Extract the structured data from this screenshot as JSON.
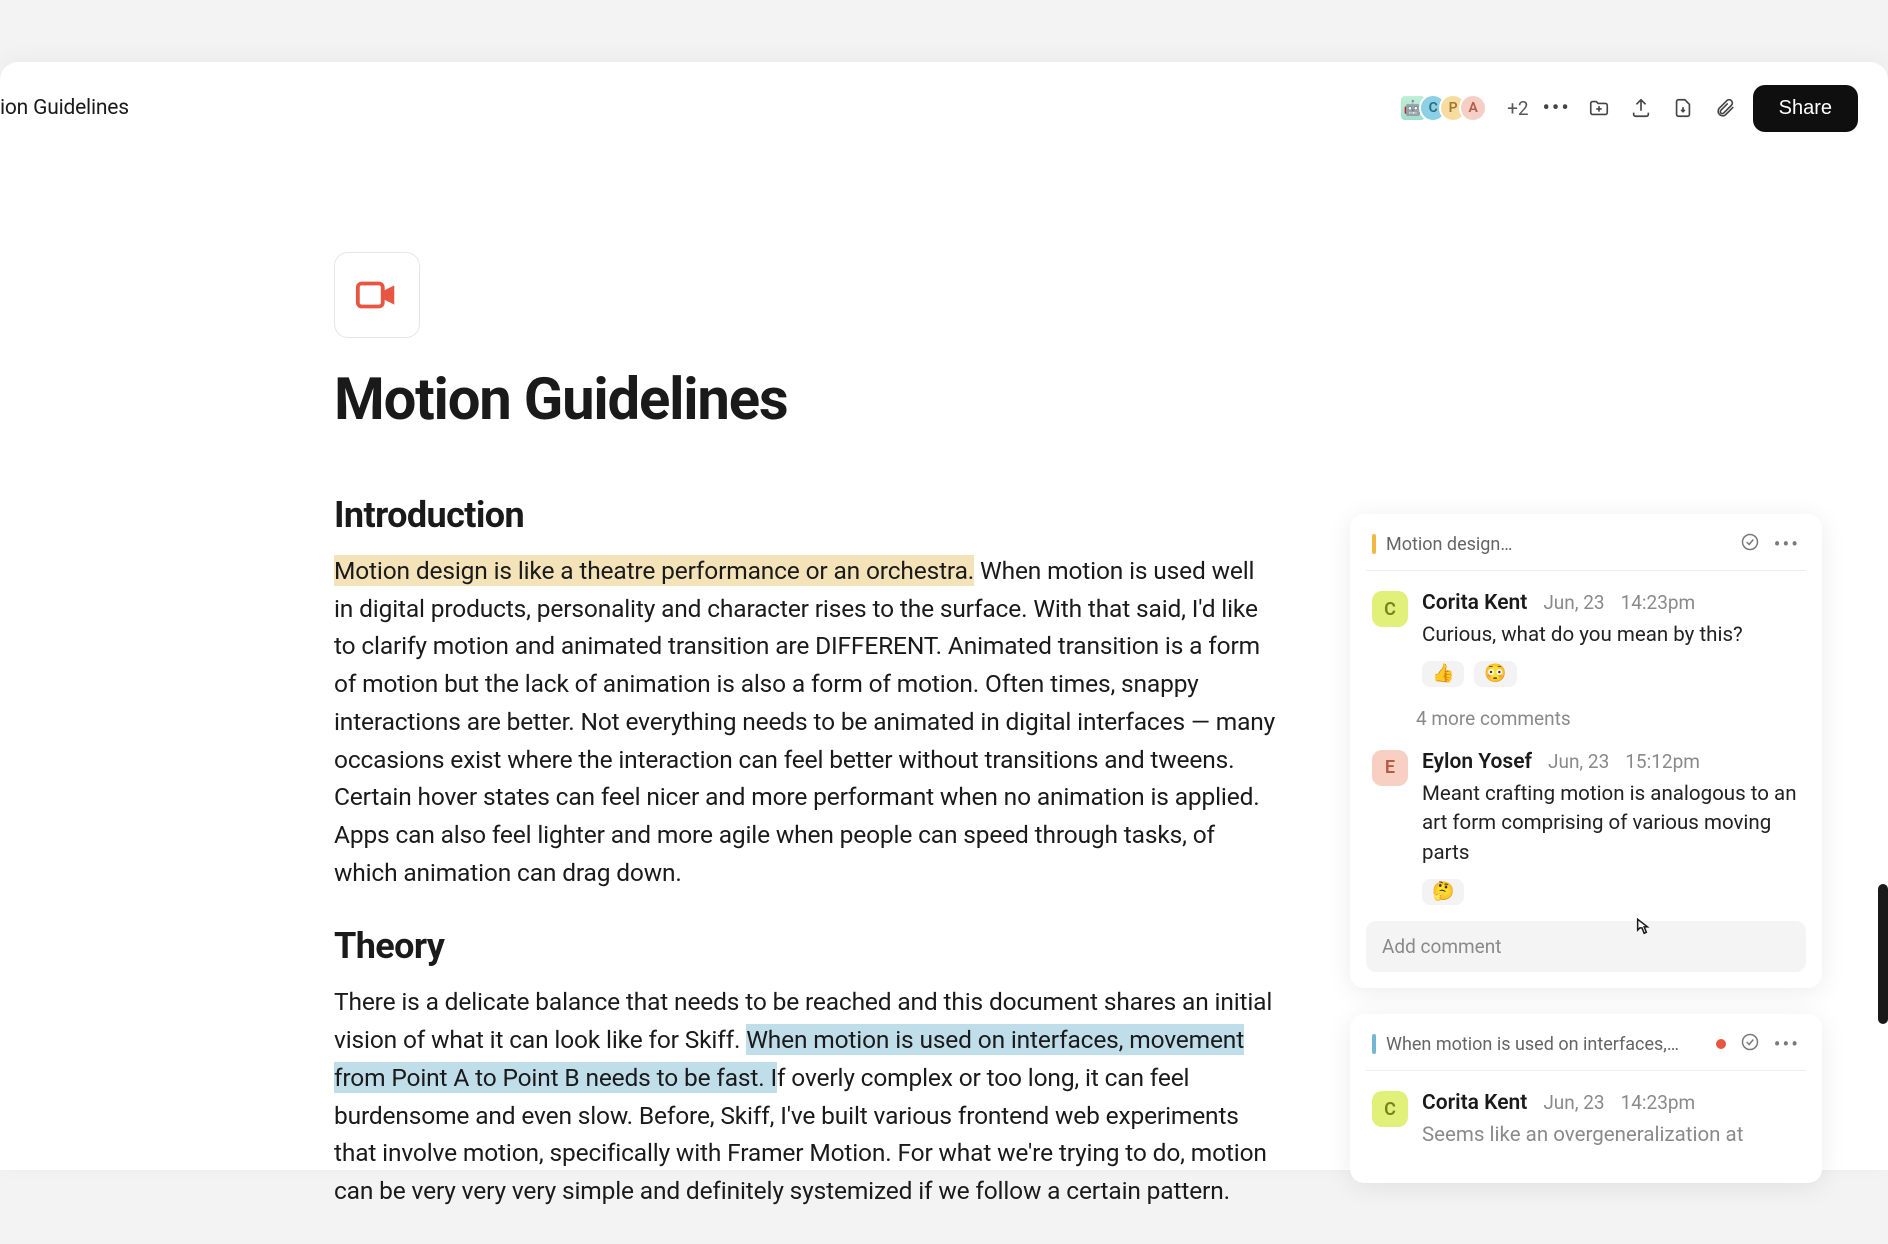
{
  "crumb_title": "ion Guidelines",
  "collaborators": {
    "plus_count": "+2",
    "av": [
      {
        "label": "🤖"
      },
      {
        "label": "C"
      },
      {
        "label": "P"
      },
      {
        "label": "A"
      }
    ]
  },
  "toolbar": {
    "share_label": "Share"
  },
  "document": {
    "title": "Motion Guidelines",
    "sections": [
      {
        "heading": "Introduction",
        "hl": "Motion design is like a theatre performance or an orchestra.",
        "rest": " When motion is used well in digital products, personality and character rises to the surface. With that said, I'd like to clarify motion and animated transition are DIFFERENT. Animated transition is a form of motion but the lack of animation is also a form of motion. Often times, snappy interactions are better. Not everything needs to be animated in digital interfaces — many occasions exist where the interaction can feel better without transitions and tweens. Certain hover states can feel nicer and more performant when no animation is applied. Apps can also feel lighter and more agile when people can speed through tasks, of which animation can drag down."
      },
      {
        "heading": "Theory",
        "pre": "There is a delicate balance that needs to be reached and this document shares an initial vision of what it can look like for Skiff. ",
        "hl": "When motion is used on interfaces, movement from Point A to Point B needs to be fast. I",
        "rest": "f overly complex or too long, it can feel burdensome and even slow. Before, Skiff, I've built various frontend web experiments that involve motion, specifically with Framer Motion. For what we're trying to do, motion can be very very very simple and definitely systemized if we follow a certain pattern."
      }
    ]
  },
  "threads": [
    {
      "snippet": "Motion design…",
      "comments": [
        {
          "initial": "C",
          "color": "green",
          "author": "Corita Kent",
          "date": "Jun, 23",
          "time": "14:23pm",
          "text": "Curious, what do you mean by this?",
          "reactions": [
            "👍",
            "😳"
          ]
        }
      ],
      "more": "4 more comments",
      "reply": {
        "initial": "E",
        "color": "pink",
        "author": "Eylon Yosef",
        "date": "Jun, 23",
        "time": "15:12pm",
        "text": "Meant crafting motion is analogous to an art form comprising of various moving parts",
        "reactions": [
          "🤔"
        ]
      },
      "add_placeholder": "Add comment"
    },
    {
      "snippet": "When motion is used on interfaces,…",
      "comments": [
        {
          "initial": "C",
          "color": "green",
          "author": "Corita Kent",
          "date": "Jun, 23",
          "time": "14:23pm",
          "text": "Seems like an overgeneralization at",
          "reactions": []
        }
      ]
    }
  ]
}
